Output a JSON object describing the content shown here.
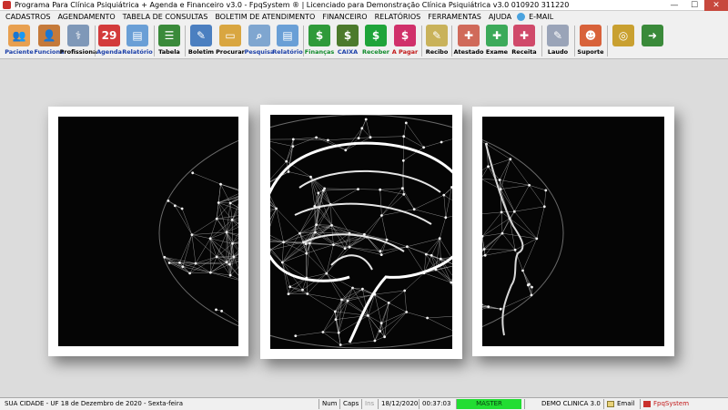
{
  "window": {
    "title": "Programa Para Clínica Psiquiátrica + Agenda e Financeiro v3.0 - FpqSystem ® | Licenciado para  Demonstração Clínica Psiquiátrica v3.0 010920 311220",
    "minimize": "—",
    "maximize": "☐",
    "close": "✕"
  },
  "menu": [
    "CADASTROS",
    "AGENDAMENTO",
    "TABELA DE CONSULTAS",
    "BOLETIM DE ATENDIMENTO",
    "FINANCEIRO",
    "RELATÓRIOS",
    "FERRAMENTAS",
    "AJUDA",
    "E-MAIL"
  ],
  "toolbar": [
    {
      "label": "Paciente",
      "icon": "people-icon",
      "glyph": "👥",
      "color": "#e8a050",
      "style": "blue"
    },
    {
      "label": "Funciona",
      "icon": "employee-icon",
      "glyph": "👤",
      "color": "#c57a3a",
      "style": "blue"
    },
    {
      "label": "Profissiona",
      "icon": "doctor-icon",
      "glyph": "⚕",
      "color": "#7f98b8",
      "style": ""
    },
    {
      "label": "Agenda",
      "icon": "calendar-icon",
      "glyph": "29",
      "color": "#d33b3b",
      "style": "blue"
    },
    {
      "label": "Relatório",
      "icon": "report-icon",
      "glyph": "▤",
      "color": "#6a9fd6",
      "style": "blue"
    },
    {
      "label": "Tabela",
      "icon": "table-icon",
      "glyph": "☰",
      "color": "#3a8a3a",
      "style": ""
    },
    {
      "label": "Boletim",
      "icon": "bulletin-icon",
      "glyph": "✎",
      "color": "#4b7fc0",
      "style": ""
    },
    {
      "label": "Procurar",
      "icon": "folder-icon",
      "glyph": "▭",
      "color": "#d9a640",
      "style": ""
    },
    {
      "label": "Pesquisa",
      "icon": "search-icon",
      "glyph": "⌕",
      "color": "#7fa6d0",
      "style": "blue"
    },
    {
      "label": "Relatório",
      "icon": "report2-icon",
      "glyph": "▤",
      "color": "#6a9fd6",
      "style": "blue"
    },
    {
      "label": "Finanças",
      "icon": "finance-icon",
      "glyph": "$",
      "color": "#2f9a3a",
      "style": "green"
    },
    {
      "label": "CAIXA",
      "icon": "cashbox-icon",
      "glyph": "$",
      "color": "#4c7a2c",
      "style": "blue"
    },
    {
      "label": "Receber",
      "icon": "receive-icon",
      "glyph": "$",
      "color": "#1fa43a",
      "style": "green"
    },
    {
      "label": "A Pagar",
      "icon": "pay-icon",
      "glyph": "$",
      "color": "#d0306a",
      "style": "red"
    },
    {
      "label": "Recibo",
      "icon": "receipt-icon",
      "glyph": "✎",
      "color": "#c9b25a",
      "style": ""
    },
    {
      "label": "Atestado",
      "icon": "certificate-icon",
      "glyph": "✚",
      "color": "#d06a5a",
      "style": ""
    },
    {
      "label": "Exame",
      "icon": "exam-icon",
      "glyph": "✚",
      "color": "#3caa5a",
      "style": ""
    },
    {
      "label": "Receita",
      "icon": "prescription-icon",
      "glyph": "✚",
      "color": "#d04a6a",
      "style": ""
    },
    {
      "label": "Laudo",
      "icon": "medical-report-icon",
      "glyph": "✎",
      "color": "#9aa4b8",
      "style": ""
    },
    {
      "label": "Suporte",
      "icon": "support-icon",
      "glyph": "☻",
      "color": "#d8623a",
      "style": ""
    },
    {
      "label": "",
      "icon": "coins-icon",
      "glyph": "◎",
      "color": "#c9a030",
      "style": ""
    },
    {
      "label": "",
      "icon": "exit-icon",
      "glyph": "➜",
      "color": "#3a8a3a",
      "style": ""
    }
  ],
  "status": {
    "location_date": "SUA CIDADE - UF 18 de Dezembro de 2020 - Sexta-feira",
    "num": "Num",
    "caps": "Caps",
    "ins": "Ins",
    "date": "18/12/2020",
    "time": "00:37:03",
    "user": "MASTER",
    "company": "DEMO CLINICA 3.0",
    "email": "Email",
    "brand": "FpqSystem"
  }
}
